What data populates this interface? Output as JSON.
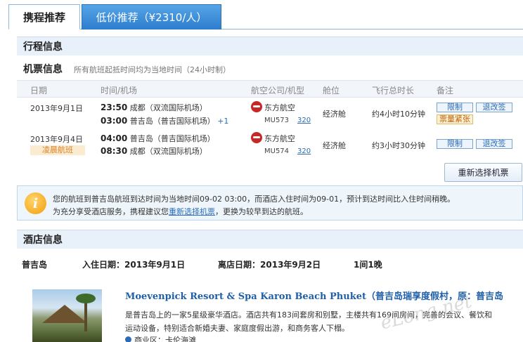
{
  "tabs": [
    {
      "label": "携程推荐"
    },
    {
      "label": "低价推荐（¥2310/人）"
    }
  ],
  "itinerary": {
    "title": "行程信息"
  },
  "tickets": {
    "title": "机票信息",
    "note": "所有航班起抵时间均为当地时间（24小时制）",
    "columns": [
      "日期",
      "时间/机场",
      "航空公司/机型",
      "舱位",
      "飞行总时长",
      "备注"
    ],
    "flights": [
      {
        "date": "2013年9月1日",
        "dep_time": "23:50",
        "dep_airport": "成都（双流国际机场）",
        "arr_time": "03:00",
        "arr_airport": "普吉岛（普吉国际机场）",
        "plus_day": "+1",
        "airline": "东方航空",
        "flight_no": "MU573",
        "plane": "320",
        "cabin": "经济舱",
        "duration": "约4小时10分钟",
        "btn_limit": "限制",
        "btn_change": "退改签",
        "warn": "票量紧张"
      },
      {
        "date": "2013年9月4日",
        "badge": "凌晨航班",
        "dep_time": "04:00",
        "dep_airport": "普吉岛（普吉国际机场）",
        "arr_time": "08:30",
        "arr_airport": "成都（双流国际机场）",
        "airline": "东方航空",
        "flight_no": "MU574",
        "plane": "320",
        "cabin": "经济舱",
        "duration": "约3小时30分钟",
        "btn_limit": "限制",
        "btn_change": "退改签"
      }
    ],
    "reselect_label": "重新选择机票"
  },
  "notice": {
    "line1": "您的航班到普吉岛航班到达时间为当地时间09-02 03:00，而酒店入住时间为09-01，预计到达时间比入住时间稍晚。",
    "line2_pre": "为充分享受酒店服务，携程建议您",
    "line2_link": "重新选择机票",
    "line2_post": "，更换为较早到达的航班。"
  },
  "hotel": {
    "title": "酒店信息",
    "city": "普吉岛",
    "checkin_label": "入住日期：",
    "checkin": "2013年9月1日",
    "checkout_label": "离店日期：",
    "checkout": "2013年9月2日",
    "rooms": "1间1晚",
    "name": "Moevenpick Resort & Spa Karon Beach Phuket（普吉岛瑞享度假村，原：普吉岛",
    "desc1": "是普吉岛上的一家5星级豪华酒店。酒店共有183间套房和别墅，主楼共有169间房间，完善的会议、餐饮和",
    "desc2": "运动设备，特别适合新婚夫妻、家庭度假出游，和商务客人下榻。",
    "area": "商业区：卡伦海滩"
  },
  "watermark": "eLong.net"
}
